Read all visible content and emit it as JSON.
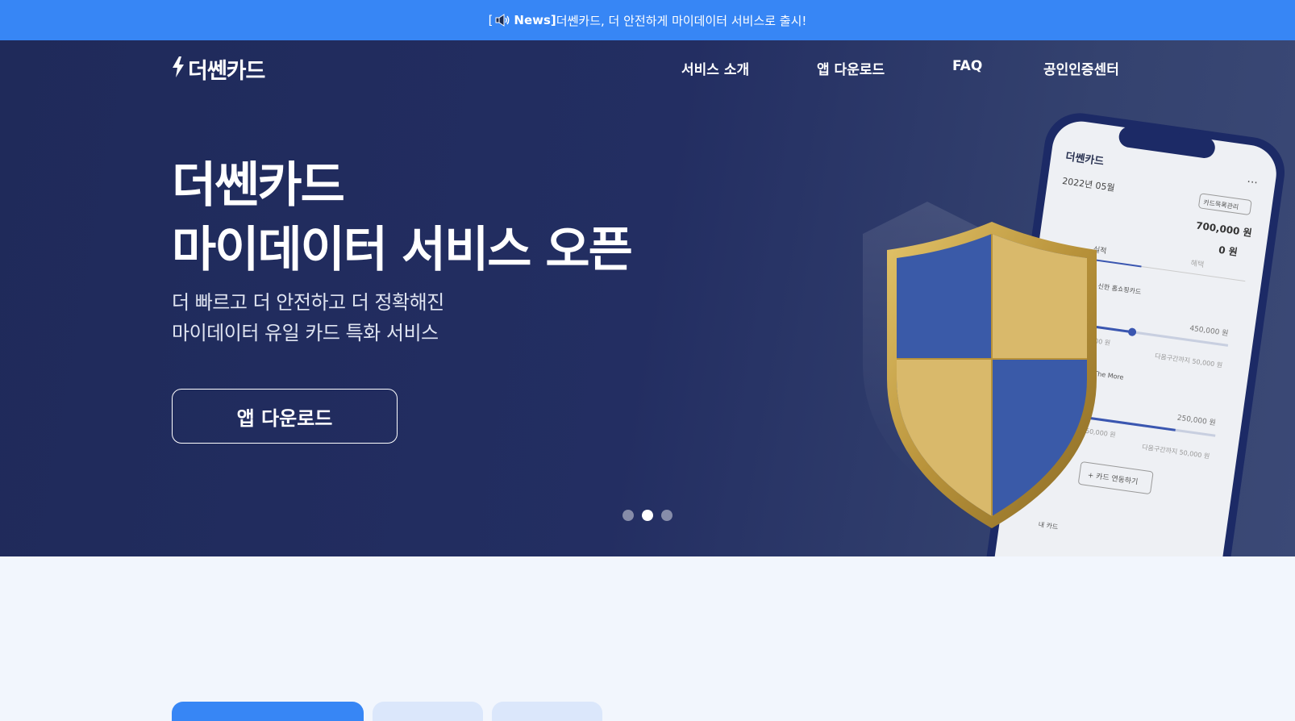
{
  "news": {
    "open_bracket": "[",
    "tag": "News]",
    "text": " 더쎈카드, 더 안전하게 마이데이터 서비스로 출시!",
    "icon": "speaker-icon"
  },
  "header": {
    "logo_text": "더쎈카드",
    "nav": [
      {
        "label": "서비스 소개"
      },
      {
        "label": "앱 다운로드"
      },
      {
        "label": "FAQ"
      },
      {
        "label": "공인인증센터"
      }
    ]
  },
  "hero": {
    "title_line1": "더쎈카드",
    "title_line2": "마이데이터 서비스 오픈",
    "sub_line1": "더 빠르고 더 안전하고 더 정확해진",
    "sub_line2": "마이데이터 유일 카드 특화 서비스",
    "cta_label": "앱 다운로드",
    "slides": 3,
    "active_slide": 2
  },
  "phone": {
    "app_logo": "더쎈카드",
    "month": "2022년 05월",
    "manage_button": "카드목록관리",
    "amount1": "700,000 원",
    "amount2": "0 원",
    "tab_label": "실적",
    "tab_label2": "혜택",
    "item1_name": "신한 홈쇼핑카드",
    "item1_amount": "450,000 원",
    "item1_note": "다음구간까지 50,000 원",
    "item1_left": "000 원",
    "item2_name": "The More",
    "item2_amount": "250,000 원",
    "item2_note": "다음구간까지 50,000 원",
    "item2_left": "실적 : 250,000 원",
    "add_card": "+ 카드 연동하기",
    "bottom_label": "내 카드"
  },
  "colors": {
    "news_bar": "#3786f5",
    "hero_bg": "#232e62",
    "shield_gold": "#c9a84a",
    "shield_blue": "#3a5aa8",
    "page_bg": "#f2f6fd"
  }
}
